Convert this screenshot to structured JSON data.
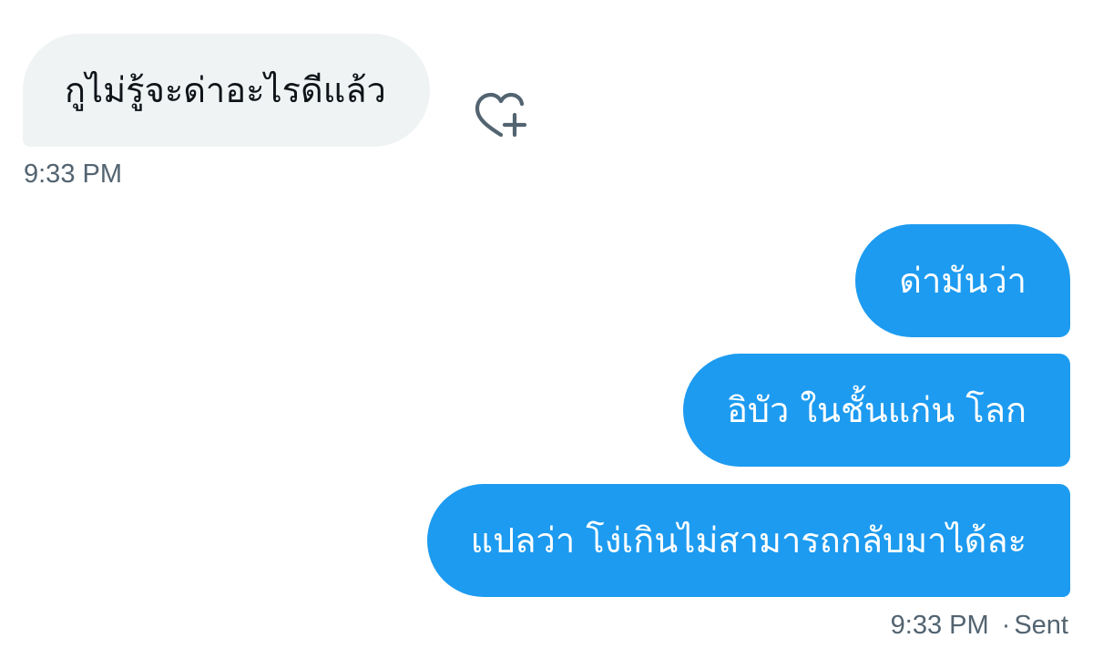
{
  "conversation": {
    "incoming": [
      {
        "text": "กูไม่รู้จะด่าอะไรดีแล้ว",
        "time": "9:33 PM"
      }
    ],
    "outgoing": [
      {
        "text": "ด่ามันว่า"
      },
      {
        "text": "อิบัว ในชั้นแก่น โลก"
      },
      {
        "text": "แปลว่า โง่เกินไม่สามารถกลับมาได้ละ"
      }
    ],
    "outgoing_meta": {
      "time": "9:33 PM",
      "separator": "·",
      "status": "Sent"
    }
  },
  "icons": {
    "react": "heart-plus-icon"
  },
  "colors": {
    "incoming_bubble": "#eff3f4",
    "incoming_text": "#0f1419",
    "outgoing_bubble": "#1d9bf0",
    "outgoing_text": "#ffffff",
    "meta_text": "#536471",
    "icon": "#536471"
  }
}
